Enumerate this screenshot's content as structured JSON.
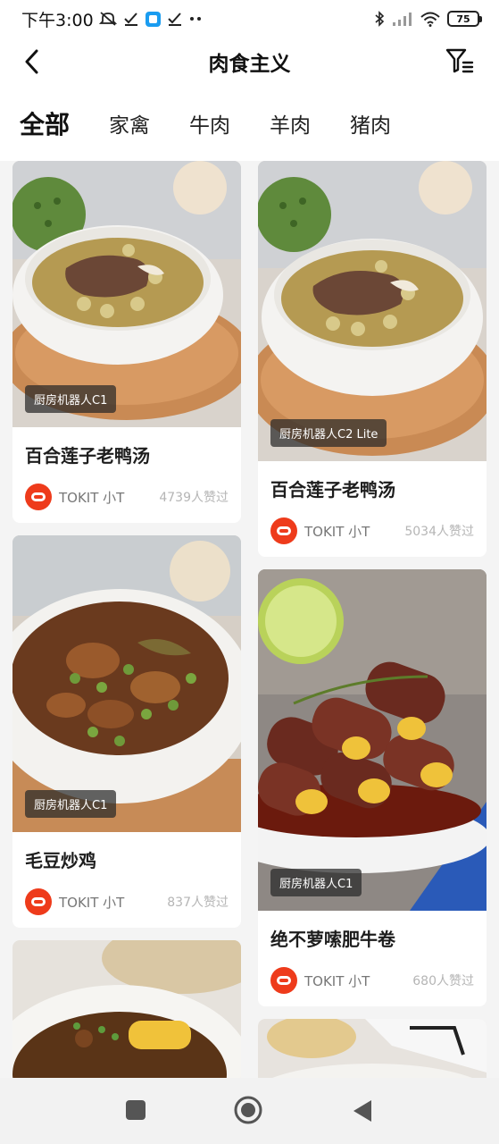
{
  "status_bar": {
    "time": "下午3:00",
    "battery": "75"
  },
  "header": {
    "title": "肉食主义",
    "back_icon": "chevron-left-icon",
    "filter_icon": "filter-icon"
  },
  "tabs": [
    {
      "label": "全部",
      "active": true
    },
    {
      "label": "家禽",
      "active": false
    },
    {
      "label": "牛肉",
      "active": false
    },
    {
      "label": "羊肉",
      "active": false
    },
    {
      "label": "猪肉",
      "active": false
    }
  ],
  "feed": {
    "left": [
      {
        "badge": "厨房机器人C1",
        "name": "百合莲子老鸭汤",
        "author": "TOKIT 小T",
        "likes": "4739人赞过"
      },
      {
        "badge": "厨房机器人C1",
        "name": "毛豆炒鸡",
        "author": "TOKIT 小T",
        "likes": "837人赞过"
      }
    ],
    "right": [
      {
        "badge": "厨房机器人C2 Lite",
        "name": "百合莲子老鸭汤",
        "author": "TOKIT 小T",
        "likes": "5034人赞过"
      },
      {
        "badge": "厨房机器人C1",
        "name": "绝不萝嗦肥牛卷",
        "author": "TOKIT 小T",
        "likes": "680人赞过"
      }
    ]
  },
  "navbar": {
    "recent_icon": "square-icon",
    "home_icon": "circle-icon",
    "back_icon": "triangle-back-icon"
  },
  "colors": {
    "accent": "#ff6a2c",
    "logo": "#ee3b1b"
  }
}
